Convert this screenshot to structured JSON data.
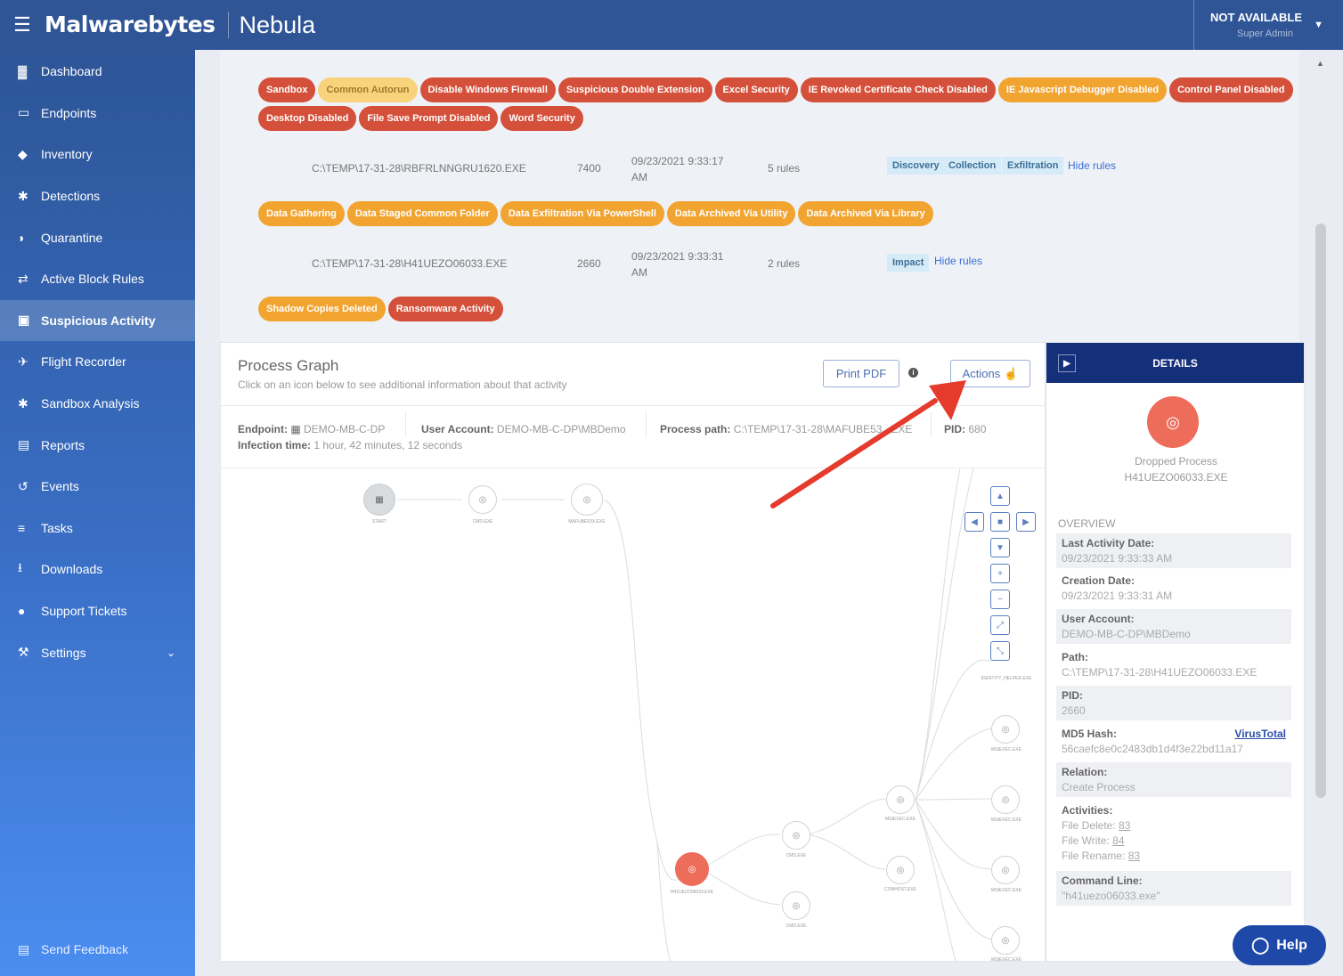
{
  "topbar": {
    "brand": "Malwarebytes",
    "product": "Nebula",
    "user_status": "NOT AVAILABLE",
    "user_role": "Super Admin"
  },
  "sidebar": {
    "items": [
      {
        "label": "Dashboard",
        "icon": "bar-chart-icon"
      },
      {
        "label": "Endpoints",
        "icon": "monitor-icon"
      },
      {
        "label": "Inventory",
        "icon": "tag-icon"
      },
      {
        "label": "Detections",
        "icon": "bug-icon"
      },
      {
        "label": "Quarantine",
        "icon": "shield-icon"
      },
      {
        "label": "Active Block Rules",
        "icon": "arrows-icon"
      },
      {
        "label": "Suspicious Activity",
        "icon": "lock-icon"
      },
      {
        "label": "Flight Recorder",
        "icon": "plane-icon"
      },
      {
        "label": "Sandbox Analysis",
        "icon": "bug-icon"
      },
      {
        "label": "Reports",
        "icon": "document-icon"
      },
      {
        "label": "Events",
        "icon": "history-icon"
      },
      {
        "label": "Tasks",
        "icon": "list-icon"
      },
      {
        "label": "Downloads",
        "icon": "download-icon"
      },
      {
        "label": "Support Tickets",
        "icon": "chat-icon"
      },
      {
        "label": "Settings",
        "icon": "wrench-icon"
      }
    ],
    "feedback": "Send Feedback"
  },
  "rules": {
    "row1_tags": [
      "Sandbox",
      "Common Autorun",
      "Disable Windows Firewall",
      "Suspicious Double Extension",
      "Excel Security",
      "IE Revoked Certificate Check Disabled",
      "IE Javascript Debugger Disabled",
      "Control Panel Disabled"
    ],
    "row2_tags": [
      "Desktop Disabled",
      "File Save Prompt Disabled",
      "Word Security"
    ],
    "proc1": {
      "path": "C:\\TEMP\\17-31-28\\RBFRLNNGRU1620.EXE",
      "pid": "7400",
      "date": "09/23/2021 9:33:17",
      "ampm": "AM",
      "rules": "5 rules",
      "categories": [
        "Discovery",
        "Collection",
        "Exfiltration"
      ],
      "hide": "Hide rules"
    },
    "row3_tags": [
      "Data Gathering",
      "Data Staged Common Folder",
      "Data Exfiltration Via PowerShell",
      "Data Archived Via Utility",
      "Data Archived Via Library"
    ],
    "proc2": {
      "path": "C:\\TEMP\\17-31-28\\H41UEZO06033.EXE",
      "pid": "2660",
      "date": "09/23/2021 9:33:31",
      "ampm": "AM",
      "rules": "2 rules",
      "categories": [
        "Impact"
      ],
      "hide": "Hide rules"
    },
    "row4_tags": [
      "Shadow Copies Deleted",
      "Ransomware Activity"
    ]
  },
  "graph": {
    "title": "Process Graph",
    "subtitle": "Click on an icon below to see additional information about that activity",
    "print_pdf": "Print PDF",
    "actions": "Actions",
    "endpoint_label": "Endpoint:",
    "endpoint_value": "DEMO-MB-C-DP",
    "user_label": "User Account:",
    "user_value": "DEMO-MB-C-DP\\MBDemo",
    "path_label": "Process path:",
    "path_value": "C:\\TEMP\\17-31-28\\MAFUBE53...EXE",
    "pid_label": "PID:",
    "pid_value": "680",
    "infection_label": "Infection time:",
    "infection_value": "1 hour, 42 minutes, 12 seconds",
    "nodes": [
      "START",
      "CMD.EXE",
      "MAFUBE53X.EXE",
      "H41UEZO06033.EXE",
      "CMD.EXE",
      "CMD.EXE",
      "MSIEXEC.EXE",
      "CONHOST.EXE",
      "IDENTITY_HELPER.EXE",
      "MSIEXEC.EXE",
      "MSIEXEC.EXE",
      "MSIEXEC.EXE",
      "MSIEXEC.EXE"
    ]
  },
  "details": {
    "header": "DETAILS",
    "node_type": "Dropped Process",
    "node_name": "H41UEZO06033.EXE",
    "overview": "OVERVIEW",
    "last_activity_label": "Last Activity Date:",
    "last_activity": "09/23/2021 9:33:33 AM",
    "creation_label": "Creation Date:",
    "creation": "09/23/2021 9:33:31 AM",
    "user_label": "User Account:",
    "user": "DEMO-MB-C-DP\\MBDemo",
    "path_label": "Path:",
    "path": "C:\\TEMP\\17-31-28\\H41UEZO06033.EXE",
    "pid_label": "PID:",
    "pid": "2660",
    "md5_label": "MD5 Hash:",
    "virustotal": "VirusTotal",
    "md5": "56caefc8e0c2483db1d4f3e22bd11a17",
    "relation_label": "Relation:",
    "relation": "Create Process",
    "activities_label": "Activities:",
    "file_delete_label": "File Delete:",
    "file_delete": "83",
    "file_write_label": "File Write:",
    "file_write": "84",
    "file_rename_label": "File Rename:",
    "file_rename": "83",
    "cmd_label": "Command Line:",
    "cmd": "\"h41uezo06033.exe\""
  },
  "help": "Help",
  "colors": {
    "brand_blue": "#2f5597",
    "tag_red": "#d4503a",
    "tag_orange": "#f2a431",
    "arrow_red": "#e53b2c",
    "details_navy": "#15307a"
  }
}
